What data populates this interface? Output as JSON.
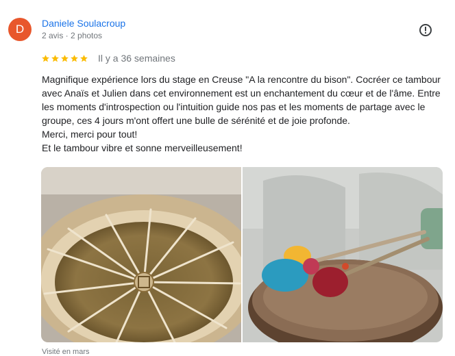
{
  "review": {
    "author_initial": "D",
    "author_name": "Daniele Soulacroup",
    "author_meta": "2 avis · 2 photos",
    "rating": 5,
    "relative_time": "Il y a 36 semaines",
    "text_paragraphs": [
      "Magnifique expérience lors du stage en Creuse \"A la rencontre du bison\". Cocréer ce tambour avec Anaïs et Julien dans cet environnement est un enchantement du cœur et de l'âme. Entre les moments d'introspection ou l'intuition guide nos pas et les moments de partage avec le groupe, ces 4 jours m'ont offert une bulle de sérénité et de joie profonde.",
      "Merci, merci pour tout!",
      "Et le tambour vibre et sonne merveilleusement!"
    ],
    "visited": "Visité en mars"
  },
  "icons": {
    "avatar": "letter-avatar",
    "menu": "report-icon",
    "star": "star-icon"
  },
  "colors": {
    "avatar_bg": "#e8572c",
    "author_link": "#1a73e8",
    "star": "#fbbc04",
    "muted_text": "#70757a"
  }
}
